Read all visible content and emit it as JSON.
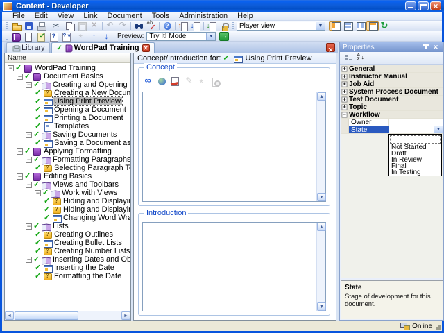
{
  "window": {
    "title": "Content - Developer"
  },
  "menu": [
    "File",
    "Edit",
    "View",
    "Link",
    "Document",
    "Tools",
    "Administration",
    "Help"
  ],
  "toolbars": {
    "standard": {
      "icons": [
        {
          "name": "open"
        },
        {
          "name": "save"
        },
        {
          "name": "print"
        },
        {
          "sep": true
        },
        {
          "name": "cut"
        },
        {
          "name": "copy"
        },
        {
          "name": "paste",
          "disabled": true
        },
        {
          "name": "delete",
          "disabled": true
        },
        {
          "sep": true
        },
        {
          "name": "undo",
          "disabled": true
        },
        {
          "name": "redo",
          "disabled": true
        },
        {
          "sep": true
        },
        {
          "name": "find"
        },
        {
          "name": "spell-check"
        },
        {
          "sep": true
        },
        {
          "name": "help"
        },
        {
          "sep": true
        },
        {
          "name": "check-out"
        },
        {
          "name": "check-in"
        },
        {
          "sep": true
        },
        {
          "name": "get-latest"
        },
        {
          "name": "lock"
        }
      ],
      "player_view": "Player view",
      "view_buttons": [
        {
          "name": "player-layout",
          "active": true
        },
        {
          "name": "developer-layout"
        },
        {
          "name": "split-layout"
        },
        {
          "name": "properties-toggle",
          "active": true
        },
        {
          "name": "refresh"
        }
      ]
    },
    "preview": {
      "icons": [
        {
          "name": "publish"
        },
        {
          "name": "export"
        },
        {
          "name": "validate"
        },
        {
          "name": "report"
        },
        {
          "name": "report-menu"
        },
        {
          "sep": true
        },
        {
          "name": "record",
          "disabled": true
        },
        {
          "name": "move-up"
        },
        {
          "name": "move-down"
        }
      ],
      "label": "Preview:",
      "mode": "Try It! Mode"
    }
  },
  "tabs": {
    "library": "Library",
    "document": "WordPad Training"
  },
  "tree": {
    "header": "Name",
    "items": [
      {
        "label": "WordPad Training",
        "level": 0,
        "icon": "book-closed",
        "expand": "minus"
      },
      {
        "label": "Document Basics",
        "level": 1,
        "icon": "book-closed",
        "expand": "minus"
      },
      {
        "label": "Creating and Opening Documents",
        "level": 2,
        "icon": "book-open",
        "expand": "minus"
      },
      {
        "label": "Creating a New Document",
        "level": 3,
        "icon": "topic"
      },
      {
        "label": "Using Print Preview",
        "level": 3,
        "icon": "simulation",
        "selected": true
      },
      {
        "label": "Opening a Document",
        "level": 3,
        "icon": "simulation"
      },
      {
        "label": "Printing a Document",
        "level": 3,
        "icon": "simulation"
      },
      {
        "label": "Templates",
        "level": 3,
        "icon": "document"
      },
      {
        "label": "Saving Documents",
        "level": 2,
        "icon": "book-open",
        "expand": "minus"
      },
      {
        "label": "Saving a Document as a New File",
        "level": 3,
        "icon": "simulation"
      },
      {
        "label": "Applying Formatting",
        "level": 1,
        "icon": "book-closed",
        "expand": "minus"
      },
      {
        "label": "Formatting Paragraphs",
        "level": 2,
        "icon": "book-open",
        "expand": "minus"
      },
      {
        "label": "Selecting Paragraph Text",
        "level": 3,
        "icon": "topic"
      },
      {
        "label": "Editing Basics",
        "level": 1,
        "icon": "book-closed",
        "expand": "minus"
      },
      {
        "label": "Views and Toolbars",
        "level": 2,
        "icon": "book-open",
        "expand": "minus"
      },
      {
        "label": "Work with Views",
        "level": 3,
        "icon": "book-open",
        "expand": "minus"
      },
      {
        "label": "Hiding and Displaying the Ruler",
        "level": 4,
        "icon": "topic"
      },
      {
        "label": "Hiding and Displaying the Status Bar",
        "level": 4,
        "icon": "topic"
      },
      {
        "label": "Changing Word Wrap Options",
        "level": 4,
        "icon": "simulation"
      },
      {
        "label": "Lists",
        "level": 2,
        "icon": "book-open",
        "expand": "minus"
      },
      {
        "label": "Creating Outlines",
        "level": 3,
        "icon": "topic"
      },
      {
        "label": "Creating Bullet Lists",
        "level": 3,
        "icon": "simulation"
      },
      {
        "label": "Creating Number Lists",
        "level": 3,
        "icon": "topic"
      },
      {
        "label": "Inserting Dates and Objects",
        "level": 2,
        "icon": "book-open",
        "expand": "minus"
      },
      {
        "label": "Inserting the Date",
        "level": 3,
        "icon": "simulation"
      },
      {
        "label": "Formatting the Date",
        "level": 3,
        "icon": "topic"
      }
    ]
  },
  "editor": {
    "header": "Concept/Introduction for:",
    "doc": "Using Print Preview",
    "concept_title": "Concept",
    "intro_title": "Introduction",
    "concept_icons": [
      {
        "name": "link"
      },
      {
        "name": "insert-web"
      },
      {
        "name": "insert-package"
      },
      {
        "sep": true
      },
      {
        "name": "edit",
        "disabled": true
      },
      {
        "name": "record",
        "disabled": true
      },
      {
        "name": "preview-doc",
        "disabled": true
      }
    ],
    "concept_value": "",
    "intro_value": ""
  },
  "properties": {
    "title": "Properties",
    "toolbar_icons": [
      {
        "name": "categorized"
      },
      {
        "name": "sort-az"
      }
    ],
    "categories": [
      {
        "label": "General"
      },
      {
        "label": "Instructor Manual"
      },
      {
        "label": "Job Aid"
      },
      {
        "label": "System Process Document"
      },
      {
        "label": "Test Document"
      },
      {
        "label": "Topic"
      },
      {
        "label": "Workflow",
        "expanded": true
      }
    ],
    "rows": [
      {
        "label": "Owner",
        "value": ""
      },
      {
        "label": "State",
        "value": "",
        "selected": true
      }
    ],
    "dropdown": [
      "",
      "Not Started",
      "Draft",
      "In Review",
      "Final",
      "In Testing"
    ],
    "description": {
      "name": "State",
      "text": "Stage of development for this document."
    }
  },
  "status": {
    "online": "Online"
  }
}
